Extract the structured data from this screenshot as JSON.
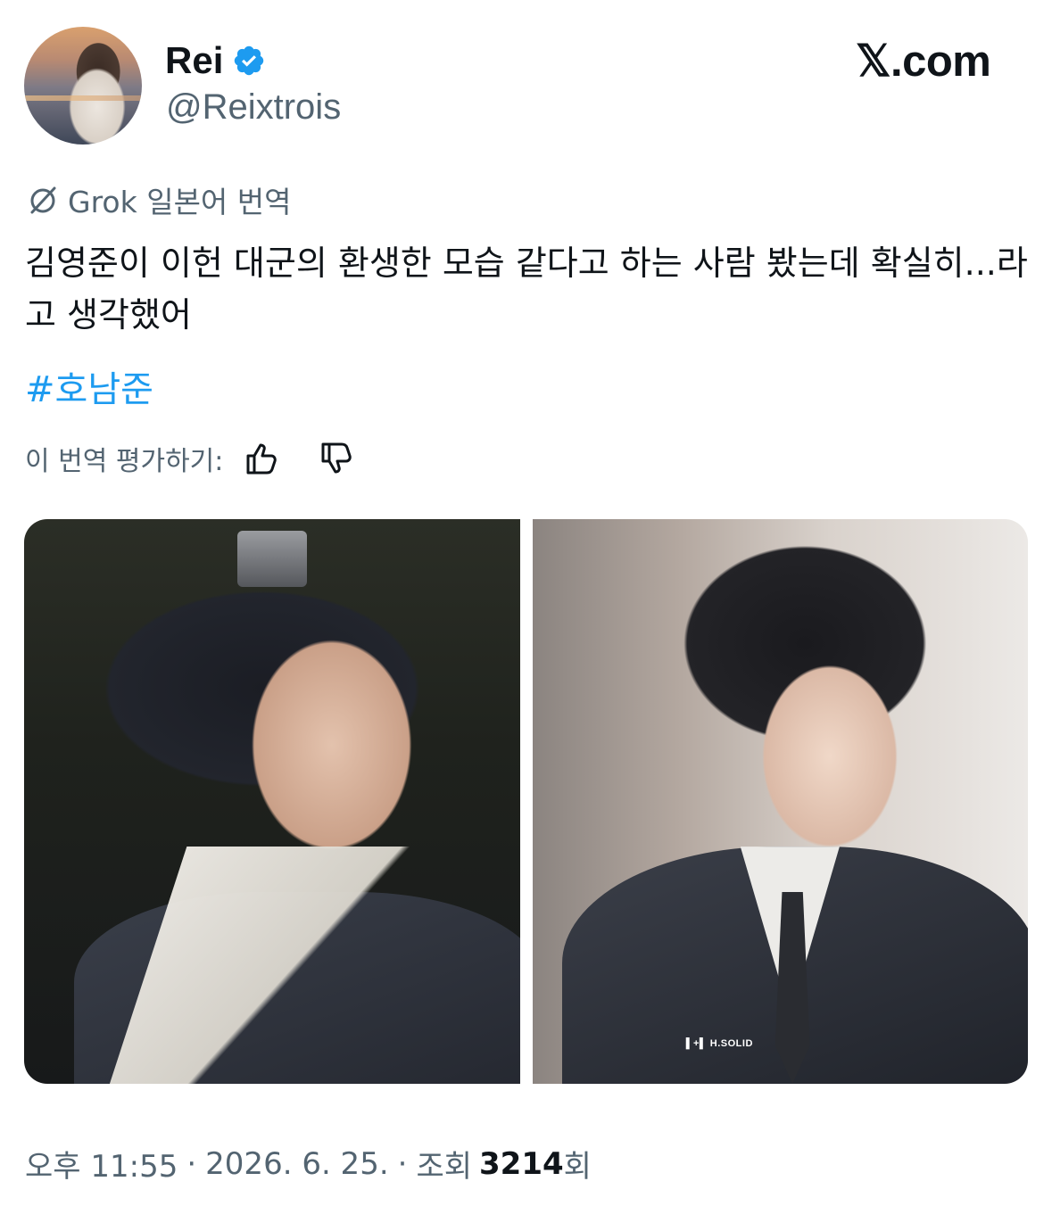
{
  "user": {
    "name": "Rei",
    "handle": "@Reixtrois",
    "verified": true,
    "verified_color": "#1d9bf0"
  },
  "brand": {
    "logo_text": "𝕏.com"
  },
  "translation": {
    "icon": "grok-icon",
    "label": "Grok 일본어 번역"
  },
  "tweet": {
    "text": "김영준이 이헌 대군의 환생한 모습 같다고 하는 사람 봤는데 확실히...라고 생각했어",
    "hashtag": "#호남준",
    "hashtag_color": "#1d9bf0"
  },
  "rating": {
    "label": "이 번역 평가하기:",
    "thumbs_up_icon": "thumbs-up-icon",
    "thumbs_down_icon": "thumbs-down-icon"
  },
  "media": {
    "count": 2,
    "watermark": "▌+▌ H.SOLID"
  },
  "footer": {
    "time": "오후 11:55",
    "separator": "·",
    "date": "2026. 6. 25.",
    "views_prefix": "조회",
    "views_count": "3214",
    "views_suffix": "회"
  }
}
